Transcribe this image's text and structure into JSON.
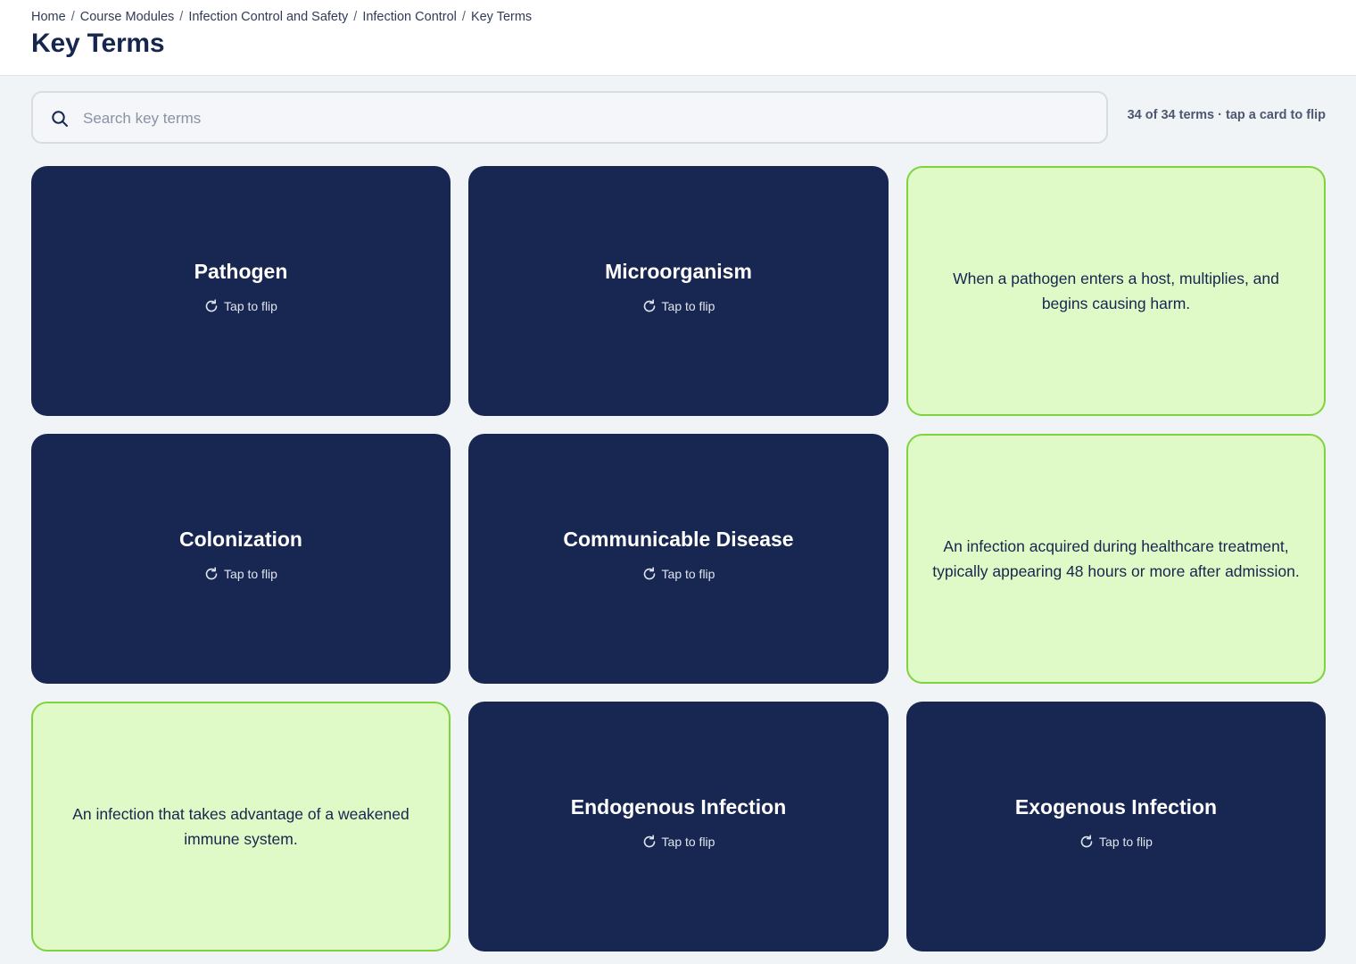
{
  "breadcrumb": {
    "items": [
      "Home",
      "Course Modules",
      "Infection Control and Safety",
      "Infection Control",
      "Key Terms"
    ],
    "separator": "/"
  },
  "page": {
    "title": "Key Terms"
  },
  "search": {
    "placeholder": "Search key terms",
    "value": "",
    "icon": "search-icon"
  },
  "status": {
    "count_text": "34 of 34 terms · tap a card to flip"
  },
  "cards": [
    {
      "side": "front",
      "term": "Pathogen",
      "hint": "Tap to flip",
      "icon": "flip-icon"
    },
    {
      "side": "front",
      "term": "Microorganism",
      "hint": "Tap to flip",
      "icon": "flip-icon"
    },
    {
      "side": "back",
      "definition": "When a pathogen enters a host, multiplies, and begins causing harm."
    },
    {
      "side": "front",
      "term": "Colonization",
      "hint": "Tap to flip",
      "icon": "flip-icon"
    },
    {
      "side": "front",
      "term": "Communicable Disease",
      "hint": "Tap to flip",
      "icon": "flip-icon"
    },
    {
      "side": "back",
      "definition": "An infection acquired during healthcare treatment, typically appearing 48 hours or more after admission."
    },
    {
      "side": "back",
      "definition": "An infection that takes advantage of a weakened immune system."
    },
    {
      "side": "front",
      "term": "Endogenous Infection",
      "hint": "Tap to flip",
      "icon": "flip-icon"
    },
    {
      "side": "front",
      "term": "Exogenous Infection",
      "hint": "Tap to flip",
      "icon": "flip-icon"
    }
  ],
  "colors": {
    "card_front_bg": "#182751",
    "card_back_bg": "#dffac7",
    "card_back_border": "#7fd33c",
    "page_bg": "#f1f4f7",
    "title": "#17264f"
  }
}
